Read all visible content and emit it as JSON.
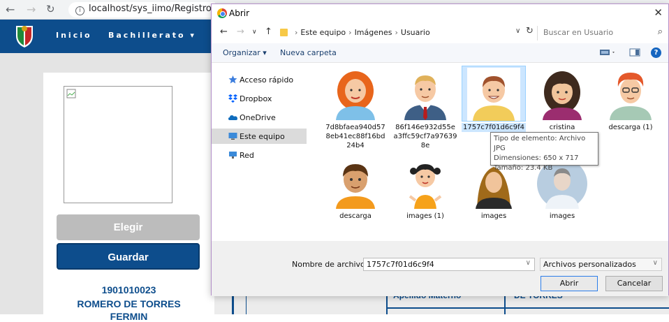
{
  "browser": {
    "url": "localhost/sys_iimo/Registros/"
  },
  "site": {
    "nav": [
      {
        "label": "Inicio"
      },
      {
        "label": "Bachillerato ▾"
      }
    ],
    "buttons": {
      "choose": "Elegir",
      "save": "Guardar"
    },
    "student": {
      "id": "1901010023",
      "name": "ROMERO DE TORRES",
      "partial_next": "FERMIN"
    },
    "table": {
      "label": "Apellido Materno",
      "value": "DE TORRES"
    }
  },
  "dialog": {
    "title": "Abrir",
    "breadcrumb": [
      "Este equipo",
      "Imágenes",
      "Usuario"
    ],
    "search_placeholder": "Buscar en Usuario",
    "toolbar": {
      "organize": "Organizar ▾",
      "new_folder": "Nueva carpeta"
    },
    "sidebar": [
      {
        "label": "Acceso rápido",
        "icon": "star-icon"
      },
      {
        "label": "Dropbox",
        "icon": "dropbox-icon"
      },
      {
        "label": "OneDrive",
        "icon": "cloud-icon"
      },
      {
        "label": "Este equipo",
        "icon": "computer-icon",
        "selected": true
      },
      {
        "label": "Red",
        "icon": "network-icon"
      }
    ],
    "files": [
      {
        "name": "7d8bfaea940d578eb41ec88f16bd24b4",
        "display": "7d8bfaea940d57 8eb41ec88f16bd 24b4"
      },
      {
        "name": "86f146e932d55ea3ffc59cf7a976398e",
        "display": "86f146e932d55e a3ffc59cf7a97639 8e"
      },
      {
        "name": "1757c7f01d6c9f4",
        "display": "1757c7f01d6c9f4",
        "selected": true
      },
      {
        "name": "cristina",
        "display": "cristina"
      },
      {
        "name": "descarga (1)",
        "display": "descarga (1)"
      },
      {
        "name": "descarga",
        "display": "descarga"
      },
      {
        "name": "images (1)",
        "display": "images (1)"
      },
      {
        "name": "images",
        "display": "images"
      },
      {
        "name": "images",
        "display": "images"
      }
    ],
    "tooltip": {
      "type": "Tipo de elemento: Archivo JPG",
      "dimensions": "Dimensiones: 650 x 717",
      "size": "Tamaño: 23.4 KB"
    },
    "filename_label": "Nombre de archivo:",
    "filename_value": "1757c7f01d6c9f4",
    "filetype": "Archivos personalizados",
    "open_button": "Abrir",
    "cancel_button": "Cancelar"
  }
}
